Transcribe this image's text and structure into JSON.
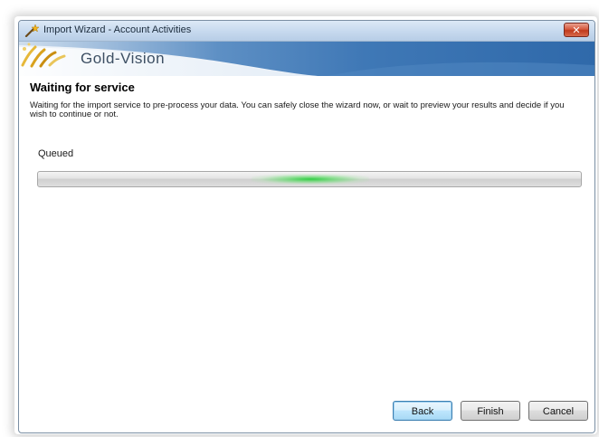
{
  "window": {
    "title": "Import Wizard - Account Activities",
    "close_label": "✕",
    "title_icon": "wand-icon"
  },
  "banner": {
    "brand_name": "Gold-Vision",
    "logo_icon": "gold-vision-logo"
  },
  "content": {
    "heading": "Waiting for service",
    "description": "Waiting for the import service to pre-process your data. You can safely close the wizard now, or wait to preview your results and decide if you wish to continue or not.",
    "status_label": "Queued",
    "progress_style": "marquee",
    "progress_color": "#2ccd3c"
  },
  "buttons": {
    "back": "Back",
    "finish": "Finish",
    "cancel": "Cancel"
  }
}
